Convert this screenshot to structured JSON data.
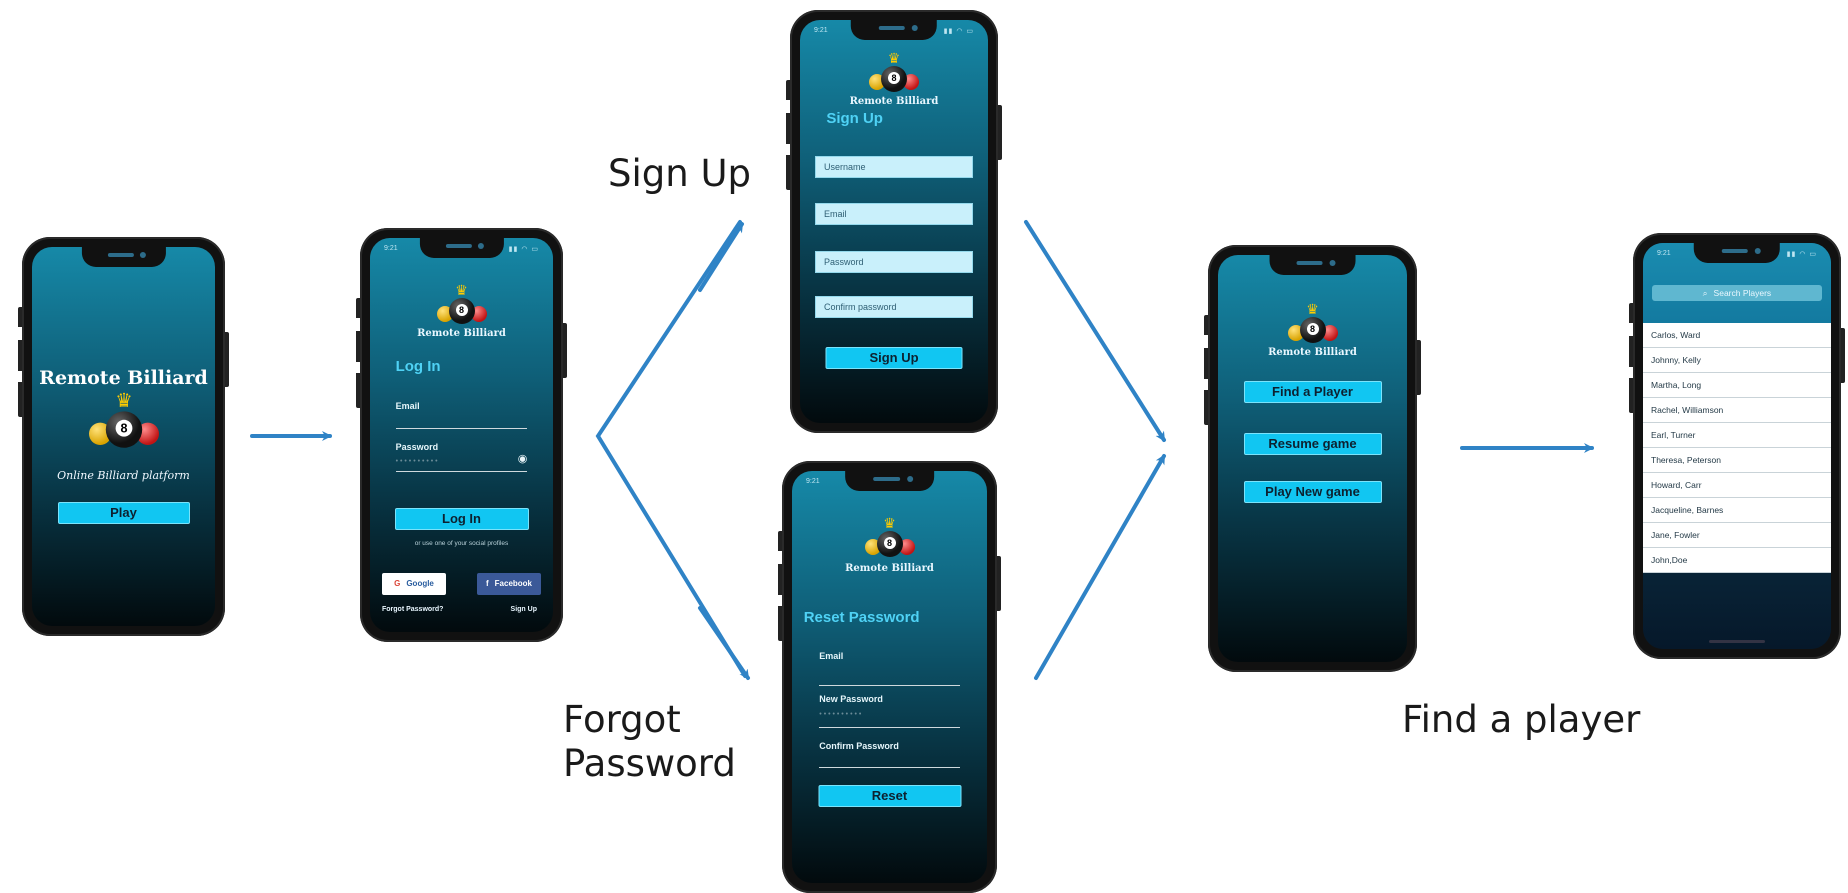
{
  "captions": {
    "sign_up": "Sign Up",
    "forgot_password": "Forgot\nPassword",
    "find_a_player": "Find a player"
  },
  "status_time": "9:21",
  "splash": {
    "title": "Remote Billiard",
    "subtitle": "Online Billiard platform",
    "play_button": "Play"
  },
  "login": {
    "logo_label": "Remote Billiard",
    "title": "Log In",
    "email_label": "Email",
    "password_label": "Password",
    "password_dots": "• • • • • • • • • •",
    "login_button": "Log In",
    "social_hint": "or use one of your social profiles",
    "google_button": "Google",
    "facebook_button": "Facebook",
    "forgot_link": "Forgot Password?",
    "signup_link": "Sign Up"
  },
  "signup": {
    "logo_label": "Remote Billiard",
    "title": "Sign Up",
    "username_placeholder": "Username",
    "email_placeholder": "Email",
    "password_placeholder": "Password",
    "confirm_placeholder": "Confirm password",
    "signup_button": "Sign Up"
  },
  "reset": {
    "logo_label": "Remote Billiard",
    "title": "Reset Password",
    "email_label": "Email",
    "new_password_label": "New Password",
    "new_password_dots": "• • • • • • • • • •",
    "confirm_label": "Confirm Password",
    "reset_button": "Reset"
  },
  "menu": {
    "logo_label": "Remote Billiard",
    "find_button": "Find a Player",
    "resume_button": "Resume game",
    "new_button": "Play New game"
  },
  "players": {
    "search_placeholder": "Search Players",
    "search_icon": "search-icon",
    "list": [
      "Carlos, Ward",
      "Johnny, Kelly",
      "Martha, Long",
      "Rachel, Williamson",
      "Earl, Turner",
      "Theresa, Peterson",
      "Howard, Carr",
      "Jacqueline, Barnes",
      "Jane, Fowler",
      "John,Doe"
    ]
  },
  "colors": {
    "accent": "#11c6f2",
    "arrow": "#2f83c6",
    "screen_top": "#1689a8",
    "screen_bottom": "#020a0d"
  }
}
